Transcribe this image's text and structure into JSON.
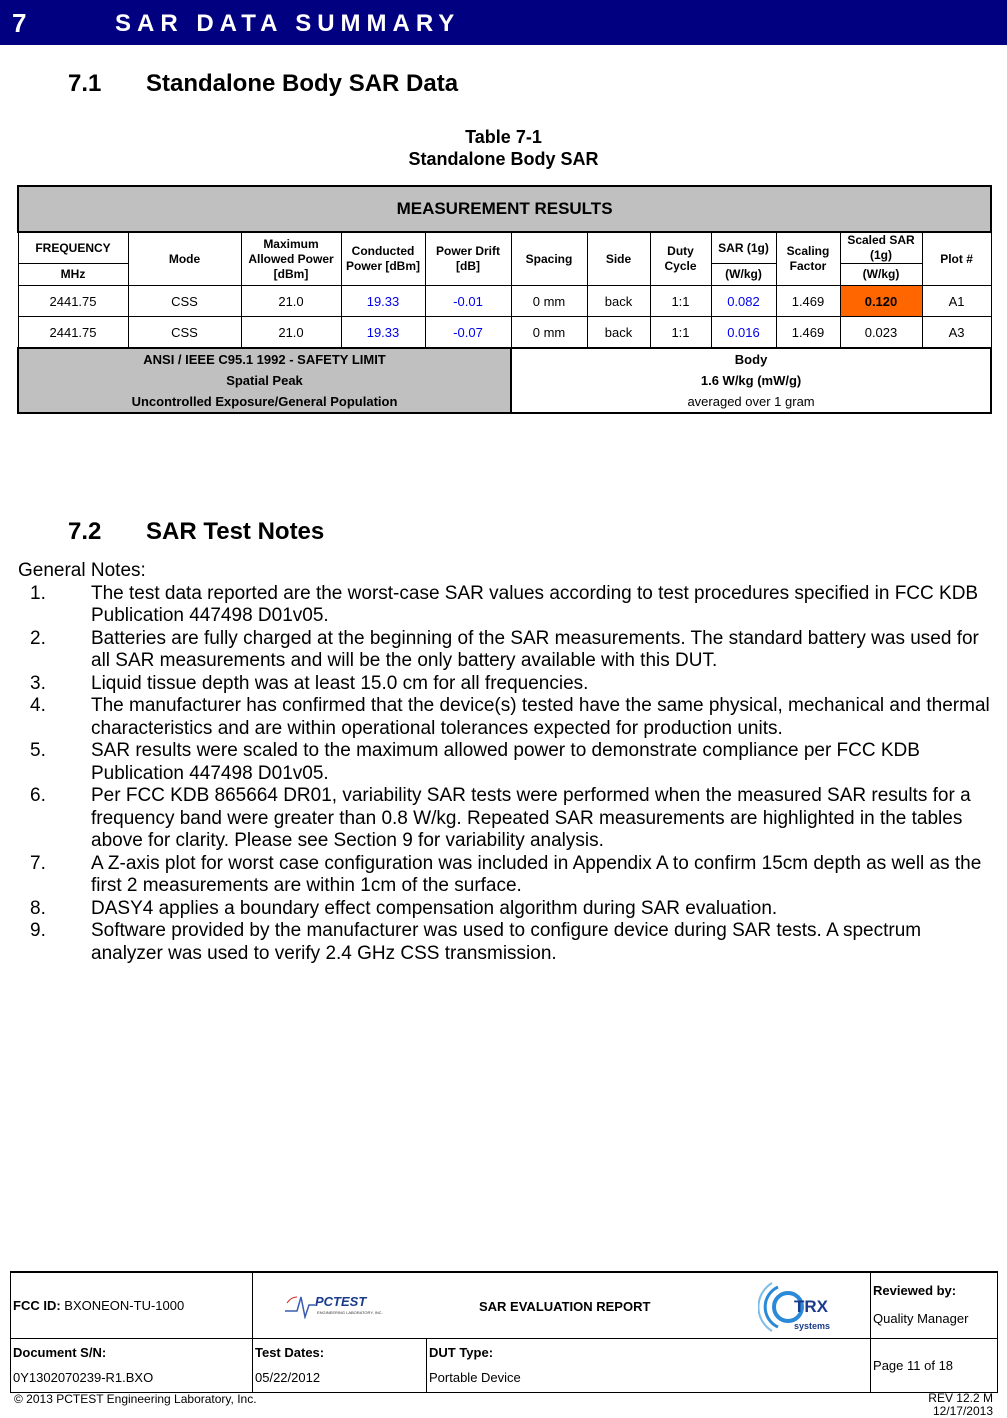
{
  "banner": {
    "number": "7",
    "title": "SAR DATA SUMMARY"
  },
  "section_71": {
    "number": "7.1",
    "title": "Standalone Body SAR Data"
  },
  "table_caption": {
    "line1": "Table 7-1",
    "line2": "Standalone Body SAR"
  },
  "table": {
    "title": "MEASUREMENT RESULTS",
    "headers": {
      "frequency": "FREQUENCY",
      "frequency_unit": "MHz",
      "mode": "Mode",
      "max_power": "Maximum Allowed Power [dBm]",
      "conducted_power": "Conducted Power [dBm]",
      "power_drift": "Power Drift [dB]",
      "spacing": "Spacing",
      "side": "Side",
      "duty_cycle": "Duty Cycle",
      "sar": "SAR (1g)",
      "sar_unit": "(W/kg)",
      "scaling": "Scaling Factor",
      "scaled_sar": "Scaled SAR (1g)",
      "scaled_sar_unit": "(W/kg)",
      "plot": "Plot #"
    },
    "rows": [
      {
        "frequency": "2441.75",
        "mode": "CSS",
        "max_power": "21.0",
        "conducted_power": "19.33",
        "power_drift": "-0.01",
        "spacing": "0 mm",
        "side": "back",
        "duty_cycle": "1:1",
        "sar": "0.082",
        "scaling": "1.469",
        "scaled_sar": "0.120",
        "plot": "A1"
      },
      {
        "frequency": "2441.75",
        "mode": "CSS",
        "max_power": "21.0",
        "conducted_power": "19.33",
        "power_drift": "-0.07",
        "spacing": "0 mm",
        "side": "back",
        "duty_cycle": "1:1",
        "sar": "0.016",
        "scaling": "1.469",
        "scaled_sar": "0.023",
        "plot": "A3"
      }
    ],
    "limit": {
      "standard": "ANSI / IEEE C95.1 1992 - SAFETY LIMIT",
      "peak": "Spatial Peak",
      "exposure": "Uncontrolled Exposure/General Population",
      "body": "Body",
      "value": "1.6 W/kg (mW/g)",
      "averaged": "averaged over 1 gram"
    },
    "colors": {
      "header_bg": "#c0c0c0",
      "highlight": "#ff6600",
      "measured_value": "#0000ee"
    }
  },
  "section_72": {
    "number": "7.2",
    "title": "SAR Test Notes"
  },
  "notes": {
    "heading": "General Notes:",
    "items": [
      {
        "n": "1.",
        "text": "The test data reported are the worst-case SAR values according to test procedures specified in FCC KDB Publication 447498 D01v05."
      },
      {
        "n": "2.",
        "text": "Batteries are fully charged at the beginning of the SAR measurements. The standard battery was used for all SAR measurements and will be the only battery available with this DUT."
      },
      {
        "n": "3.",
        "text": "Liquid tissue depth was at least 15.0 cm for all frequencies."
      },
      {
        "n": "4.",
        "text": "The manufacturer has confirmed that the device(s) tested have the same physical, mechanical and thermal characteristics and are within operational tolerances expected for production units."
      },
      {
        "n": "5.",
        "text": "SAR results were scaled to the maximum allowed power to demonstrate compliance per FCC KDB Publication 447498 D01v05."
      },
      {
        "n": "6.",
        "text": "Per FCC KDB 865664 DR01, variability SAR tests were performed when the measured SAR results for a frequency band were greater than 0.8 W/kg. Repeated SAR measurements are highlighted in the tables above for clarity. Please see Section 9 for variability analysis."
      },
      {
        "n": "7.",
        "text": "A Z-axis plot for worst case configuration was included in Appendix A to confirm 15cm depth as well as the first 2 measurements are within 1cm of the surface."
      },
      {
        "n": "8.",
        "text": "DASY4 applies a boundary effect compensation algorithm during SAR evaluation."
      },
      {
        "n": "9.",
        "text": "Software provided by the manufacturer was used to configure device during SAR tests.  A spectrum analyzer was used to verify 2.4 GHz CSS transmission."
      }
    ]
  },
  "footer": {
    "fcc_label": "FCC ID:",
    "fcc_value": "BXONEON-TU-1000",
    "pctest_logo": "PCTEST",
    "pctest_sub": "ENGINEERING LABORATORY, INC.",
    "report_title": "SAR EVALUATION REPORT",
    "trx_logo": "TRX",
    "trx_sub": "systems",
    "reviewed_label": "Reviewed by:",
    "reviewed_value": "Quality Manager",
    "doc_label": "Document S/N:",
    "doc_value": "0Y1302070239-R1.BXO",
    "dates_label": "Test Dates:",
    "dates_value": "05/22/2012",
    "dut_label": "DUT Type:",
    "dut_value": "Portable Device",
    "page": "Page 11 of 18",
    "copyright": "© 2013 PCTEST Engineering Laboratory, Inc.",
    "rev": "REV 12.2 M",
    "rev_date": "12/17/2013"
  }
}
